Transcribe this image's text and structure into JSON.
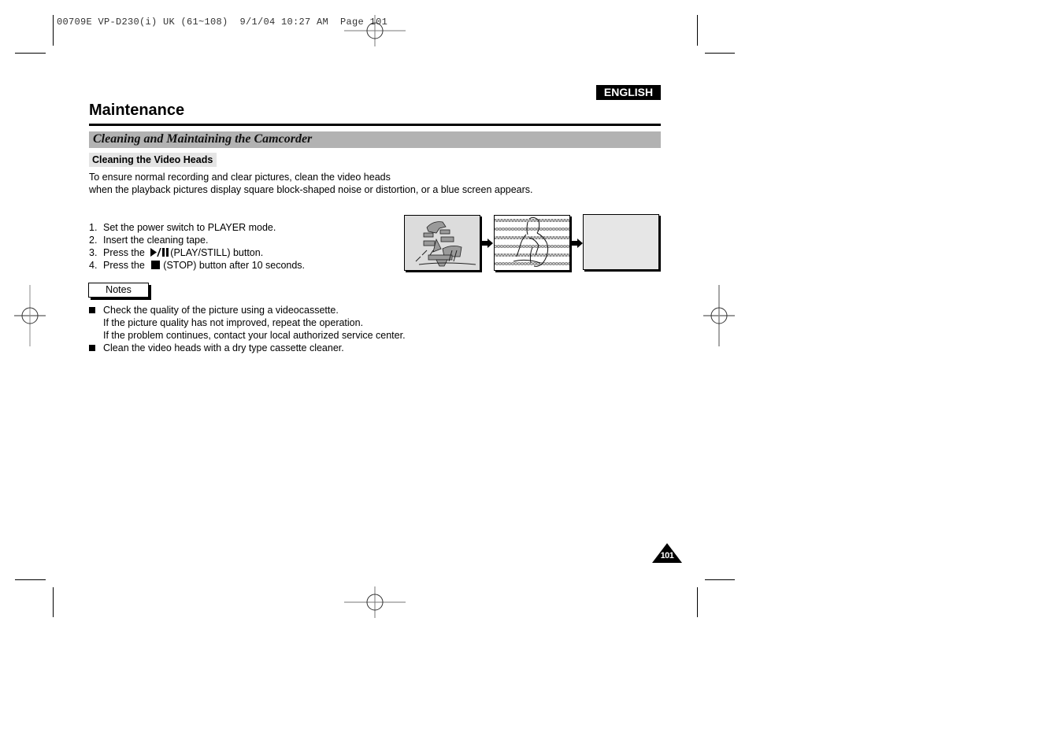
{
  "print_slug": "00709E VP-D230(i) UK (61~108)  9/1/04 10:27 AM  Page 101",
  "language_badge": "ENGLISH",
  "page_title": "Maintenance",
  "section_title": "Cleaning and Maintaining the Camcorder",
  "subsection_title": "Cleaning the Video Heads",
  "intro": {
    "line1": "To ensure normal recording and clear pictures, clean the video heads",
    "line2": "when the playback pictures display square block-shaped noise or distortion, or a blue screen appears."
  },
  "steps": [
    {
      "num": "1.",
      "text": "Set the power switch to PLAYER mode."
    },
    {
      "num": "2.",
      "text": "Insert the cleaning tape."
    },
    {
      "num": "3.",
      "prefix": "Press the",
      "icon": "play-pause-icon",
      "suffix": "(PLAY/STILL) button."
    },
    {
      "num": "4.",
      "prefix": "Press the",
      "icon": "stop-icon",
      "suffix": "(STOP) button after 10 seconds."
    }
  ],
  "notes_label": "Notes",
  "notes": [
    {
      "lines": [
        "Check the quality of the picture using a videocassette.",
        "If the picture quality has not improved, repeat the operation.",
        "If the problem continues, contact your local authorized service center."
      ]
    },
    {
      "lines": [
        "Clean the video heads with a dry type cassette cleaner."
      ]
    }
  ],
  "illustrations": [
    {
      "name": "distorted-picture",
      "description": "block-shaped noise picture"
    },
    {
      "name": "striped-noise-picture",
      "description": "horizontal noise stripes picture"
    },
    {
      "name": "blank-screen",
      "description": "blank screen"
    }
  ],
  "page_number": "101",
  "colors": {
    "section_bar": "#b2b2b2",
    "subsection_bg": "#e4e4e4",
    "badge_bg": "#000000",
    "badge_text": "#ffffff"
  }
}
